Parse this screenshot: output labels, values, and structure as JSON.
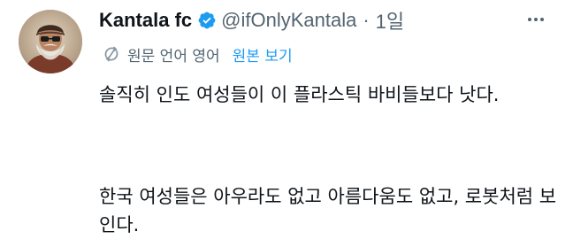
{
  "tweet": {
    "display_name": "Kantala fc",
    "verified": true,
    "handle": "@ifOnlyKantala",
    "separator": "·",
    "time": "1일",
    "translate": {
      "label": "원문 언어 영어",
      "link": "원본 보기"
    },
    "paragraphs": [
      "솔직히 인도 여성들이 이 플라스틱 바비들보다 낫다.",
      "한국 여성들은 아우라도 없고 아름다움도 없고, 로봇처럼 보인다."
    ]
  },
  "colors": {
    "text": "#0f1419",
    "muted": "#536471",
    "accent": "#1d9bf0"
  },
  "icons": {
    "verified": "verified-badge-icon",
    "translate": "translate-icon",
    "more": "more-options-icon"
  }
}
